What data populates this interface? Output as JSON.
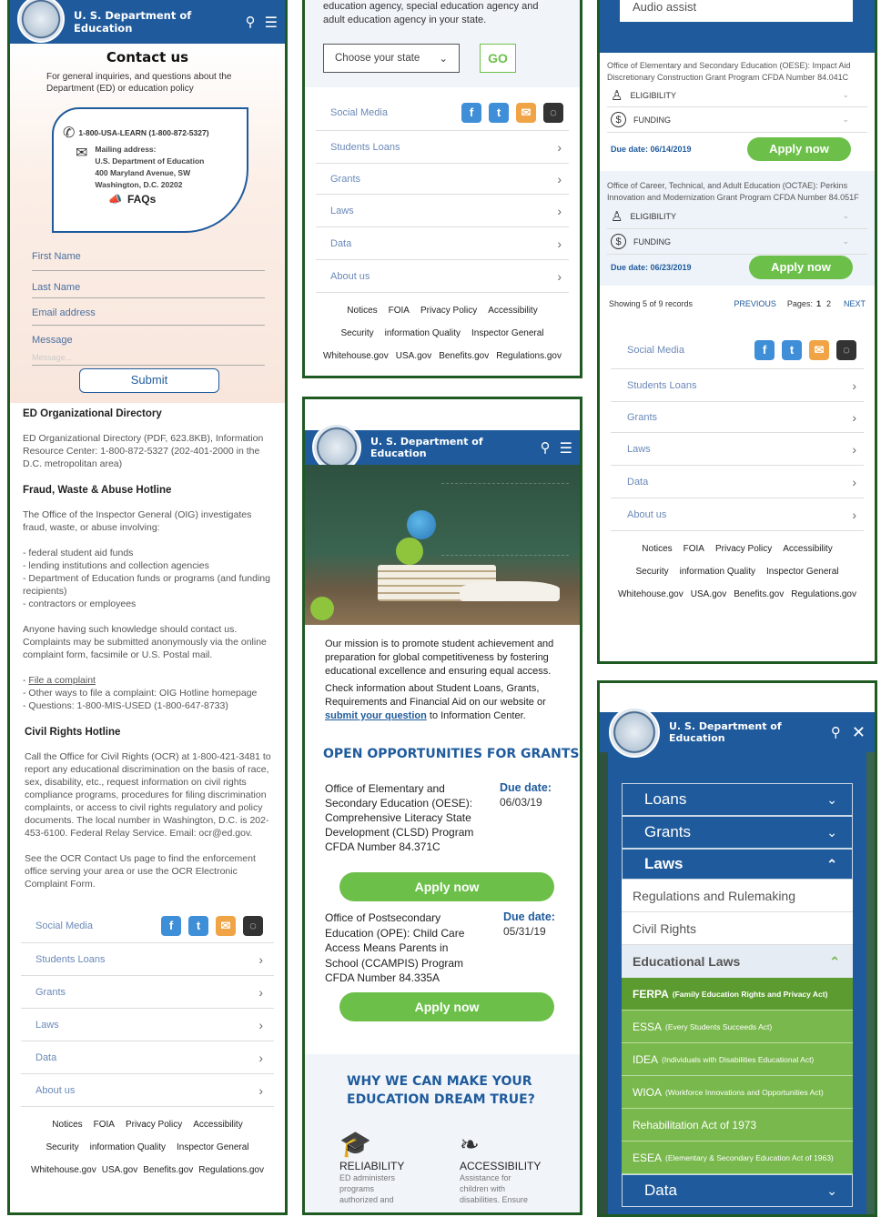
{
  "header": {
    "title": "U. S. Department of Education"
  },
  "contact": {
    "title": "Contact us",
    "intro": "For general inquiries, and questions about the Department (ED) or education policy",
    "phone": "1-800-USA-LEARN (1-800-872-5327)",
    "mail_label": "Mailing address:",
    "mail_line1": "U.S. Department of Education",
    "mail_line2": "400 Maryland Avenue, SW",
    "mail_line3": "Washington, D.C. 20202",
    "faqs": "FAQs",
    "fields": [
      "First Name",
      "Last Name",
      "Email address",
      "Message"
    ],
    "message_placeholder": "Message...",
    "submit": "Submit"
  },
  "directory": {
    "title": "ED Organizational Directory",
    "text": "ED Organizational Directory (PDF, 623.8KB), Information Resource Center: 1-800-872-5327 (202-401-2000 in the D.C. metropolitan area)"
  },
  "fraud": {
    "title": "Fraud, Waste & Abuse Hotline",
    "intro": "The Office of the Inspector General (OIG) investigates fraud, waste, or abuse involving:",
    "items": [
      "- federal student aid funds",
      "- lending institutions and collection agencies",
      "- Department of Education funds or programs (and funding recipients)",
      "- contractors or employees"
    ],
    "p2": "Anyone having such knowledge should contact us. Complaints may be submitted anonymously via the online complaint form, facsimile or U.S. Postal mail.",
    "link_prefix": "- ",
    "link": "File a complaint",
    "l2": "- Other ways to file a complaint: OIG Hotline homepage",
    "l3": "- Questions: 1-800-MIS-USED (1-800-647-8733)"
  },
  "civil": {
    "title": "Civil Rights Hotline",
    "p1": "Call the Office for Civil Rights (OCR) at 1-800-421-3481 to report any educational discrimination on the basis of race, sex, disability, etc., request information on civil rights compliance programs, procedures for filing discrimination complaints, or access to civil rights regulatory and policy documents. The local number in Washington, D.C. is 202-453-6100. Federal Relay Service. Email: ocr@ed.gov.",
    "p2": "See the OCR Contact Us page to find the enforcement office serving your area or use the OCR Electronic Complaint Form."
  },
  "footer": {
    "social": "Social Media",
    "nav": [
      "Students Loans",
      "Grants",
      "Laws",
      "Data",
      "About us"
    ],
    "row1": [
      "Notices",
      "FOIA",
      "Privacy Policy",
      "Accessibility"
    ],
    "row2": [
      "Security",
      "information Quality",
      "Inspector General"
    ],
    "row3": [
      "Whitehouse.gov",
      "USA.gov",
      "Benefits.gov",
      "Regulations.gov"
    ]
  },
  "state": {
    "text": "education agency, special education agency and adult education agency in your state.",
    "select": "Choose your state",
    "go": "GO"
  },
  "home": {
    "mission": "Our mission is to promote student achievement and preparation for global competitiveness by fostering educational excellence and ensuring equal access.",
    "check_prefix": "Check information about Student Loans, Grants, Requirements and Financial Aid on our website or ",
    "check_link": "submit your question",
    "check_suffix": " to Information Center.",
    "grants_title": "OPEN OPPORTUNITIES FOR GRANTS",
    "due_label": "Due date:",
    "grant1": "Office of Elementary and Secondary Education (OESE): Comprehensive Literacy State Development (CLSD) Program CFDA Number 84.371C",
    "grant1_due": "06/03/19",
    "grant2": "Office of Postsecondary Education (OPE): Child Care Access Means Parents in School (CCAMPIS) Program CFDA Number 84.335A",
    "grant2_due": "05/31/19",
    "apply": "Apply now",
    "why_title": "WHY WE CAN MAKE YOUR EDUCATION DREAM TRUE?",
    "rel_title": "RELIABILITY",
    "rel_text": "ED administers programs authorized and",
    "acc_title": "ACCESSIBILITY",
    "acc_text": "Assistance for children with disabilities. Ensure"
  },
  "grants_list": {
    "search_value": "Audio assist",
    "g1": "Office of Elementary and Secondary Education (OESE): Impact Aid Discretionary Construction Grant Program CFDA Number 84.041C",
    "g2": "Office of Career, Technical, and Adult Education (OCTAE): Perkins Innovation and Modernization Grant Program CFDA Number 84.051F",
    "eligibility": "ELIGIBILITY",
    "funding": "FUNDING",
    "due1": "Due date: 06/14/2019",
    "due2": "Due date: 06/23/2019",
    "apply": "Apply now",
    "showing": "Showing 5 of 9 records",
    "previous": "PREVIOUS",
    "pages_label": "Pages:",
    "page1": "1",
    "page2": "2",
    "next": "NEXT"
  },
  "menu": {
    "loans": "Loans",
    "grants": "Grants",
    "laws": "Laws",
    "regs": "Regulations and Rulemaking",
    "civil": "Civil Rights",
    "edu_laws": "Educational Laws",
    "laws_items": [
      {
        "abbr": "FERPA",
        "full": "(Family Education Rights and Privacy Act)"
      },
      {
        "abbr": "ESSA",
        "full": "(Every Students Succeeds Act)"
      },
      {
        "abbr": "IDEA",
        "full": "(Individuals with Disabilities Educational Act)"
      },
      {
        "abbr": "WIOA",
        "full": "(Workforce Innovations and Opportunities Act)"
      },
      {
        "abbr": "Rehabilitation Act of 1973",
        "full": ""
      },
      {
        "abbr": "ESEA",
        "full": "(Elementary & Secondary Education Act of 1963)"
      }
    ],
    "data": "Data"
  },
  "colors": {
    "brand_blue": "#1f5b9c",
    "green": "#6cc04a",
    "frame": "#1e5a22"
  }
}
